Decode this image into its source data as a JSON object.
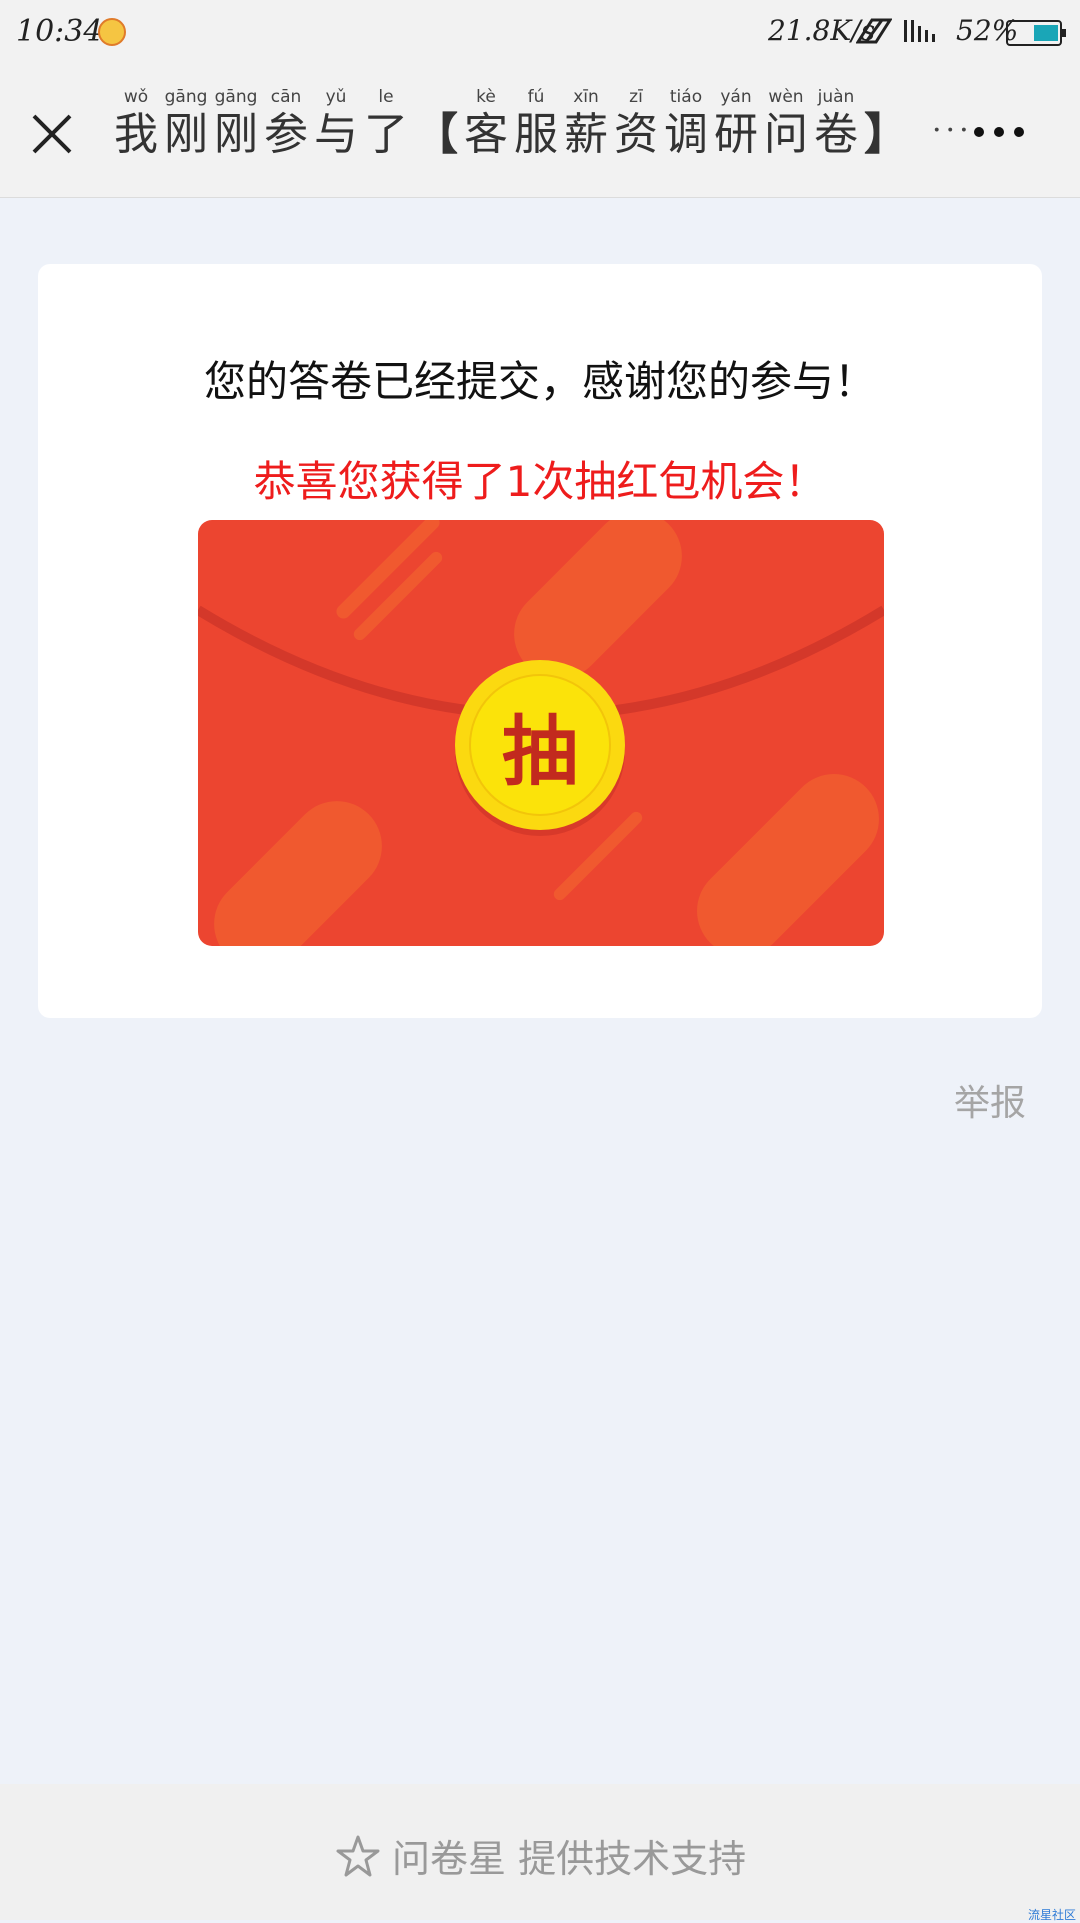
{
  "status_bar": {
    "time": "10:34",
    "speed": "21.8K/s",
    "battery_pct": "52%",
    "colors": {
      "battery_fill": "#1aa6b7"
    }
  },
  "nav": {
    "title_chars": [
      {
        "py": "wǒ",
        "hz": "我"
      },
      {
        "py": "gāng",
        "hz": "刚"
      },
      {
        "py": "gāng",
        "hz": "刚"
      },
      {
        "py": "cān",
        "hz": "参"
      },
      {
        "py": "yǔ",
        "hz": "与"
      },
      {
        "py": "le",
        "hz": "了"
      },
      {
        "py": "",
        "hz": "【"
      },
      {
        "py": "kè",
        "hz": "客"
      },
      {
        "py": "fú",
        "hz": "服"
      },
      {
        "py": "xīn",
        "hz": "薪"
      },
      {
        "py": "zī",
        "hz": "资"
      },
      {
        "py": "tiáo",
        "hz": "调"
      },
      {
        "py": "yán",
        "hz": "研"
      },
      {
        "py": "wèn",
        "hz": "问"
      },
      {
        "py": "juàn",
        "hz": "卷"
      },
      {
        "py": "",
        "hz": "】"
      }
    ],
    "title_overflow": "···",
    "close_icon": "close-icon",
    "more_icon": "more-icon"
  },
  "card": {
    "thanks_text": "您的答卷已经提交，感谢您的参与！",
    "congrats_text": "恭喜您获得了1次抽红包机会！",
    "envelope": {
      "coin_label": "抽",
      "colors": {
        "envelope": "#ec4530",
        "coin": "#fbd910",
        "coin_text": "#c22a1e"
      }
    }
  },
  "report_label": "举报",
  "footer": {
    "star_icon": "star-icon",
    "text": "问卷星 提供技术支持"
  },
  "watermark": "流星社区"
}
